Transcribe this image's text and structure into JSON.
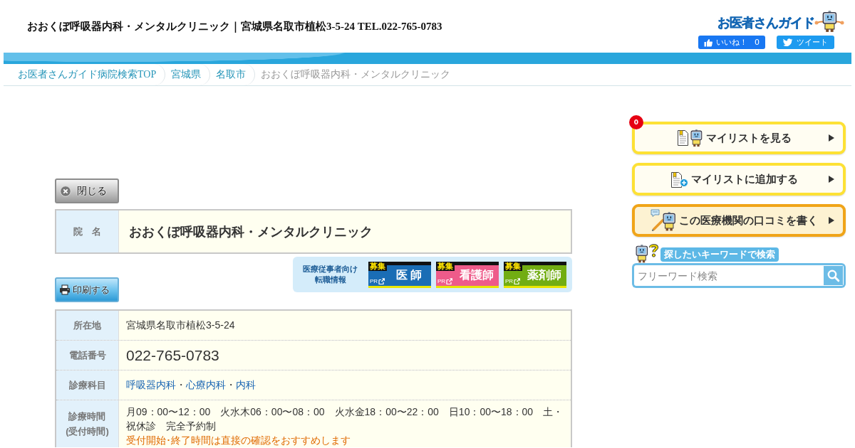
{
  "header": {
    "title": "おおくぼ呼吸器内科・メンタルクリニック｜宮城県名取市植松3-5-24 TEL.022-765-0783",
    "logo": "お医者さんガイド",
    "like_button": {
      "label": "いいね！",
      "count": "0"
    },
    "tweet_button": {
      "label": "ツイート"
    }
  },
  "breadcrumb": [
    {
      "label": "お医者さんガイド病院検索TOP",
      "current": false
    },
    {
      "label": "宮城県",
      "current": false
    },
    {
      "label": "名取市",
      "current": false
    },
    {
      "label": "おおくぼ呼吸器内科・メンタルクリニック",
      "current": true
    }
  ],
  "clinic": {
    "close_button": "閉じる",
    "name_label": "院　名",
    "name": "おおくぼ呼吸器内科・メンタルクリニック",
    "print_button": "印刷する",
    "recruit": {
      "heading": [
        "医療従事者向け",
        "転職情報"
      ],
      "tiles": [
        {
          "tag": "募集",
          "pr": "PR",
          "label": "医 師",
          "color": "#1a6db5"
        },
        {
          "tag": "募集",
          "pr": "PR",
          "label": "看護師",
          "color": "#ee5b8a"
        },
        {
          "tag": "募集",
          "pr": "PR",
          "label": "薬剤師",
          "color": "#72ad12"
        }
      ]
    },
    "rows": [
      {
        "kind": "text",
        "label": [
          "所在地"
        ],
        "value": "宮城県名取市植松3-5-24"
      },
      {
        "kind": "phone",
        "label": [
          "電話番号"
        ],
        "value": "022-765-0783"
      },
      {
        "kind": "links",
        "label": [
          "診療科目"
        ],
        "parts": [
          {
            "kind": "link",
            "text": "呼吸器内科"
          },
          {
            "kind": "separator",
            "text": "・"
          },
          {
            "kind": "link",
            "text": "心療内科"
          },
          {
            "kind": "separator",
            "text": "・"
          },
          {
            "kind": "link",
            "text": "内科"
          }
        ]
      },
      {
        "kind": "hours",
        "label": [
          "診療時間",
          "(受付時間)"
        ],
        "value": "月09：00〜12：00　火水木06：00〜08：00　火水金18：00〜22：00　日10：00〜18：00　土・祝休診　完全予約制",
        "note": "受付開始･終了時間は直接の確認をおすすめします"
      }
    ]
  },
  "sidebar": {
    "buttons": [
      {
        "kind": "mylist_view",
        "label": "マイリストを見る",
        "badge": "0"
      },
      {
        "kind": "mylist_add",
        "label": "マイリストに追加する"
      },
      {
        "kind": "review",
        "label": "この医療機関の口コミを書く"
      }
    ],
    "search": {
      "label": "探したいキーワードで検索",
      "placeholder": "フリーワード検索"
    }
  }
}
